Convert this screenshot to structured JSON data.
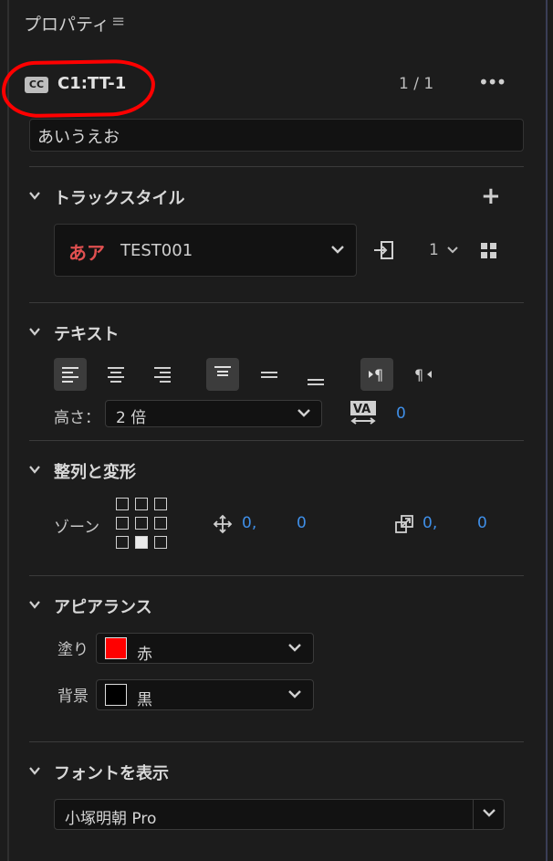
{
  "panel": {
    "title": "プロパティ",
    "menu_icon": "hamburger-icon"
  },
  "caption": {
    "badge": "CC",
    "name": "C1:TT-1",
    "page": "1 / 1",
    "more_icon": "more-icon",
    "text": "あいうえお"
  },
  "track_style": {
    "title": "トラックスタイル",
    "preview": "あア",
    "style_name": "TEST001",
    "count": "1"
  },
  "text_section": {
    "title": "テキスト",
    "height_label": "高さ：",
    "height_value": "2 倍",
    "tracking_value": "0"
  },
  "align_section": {
    "title": "整列と変形",
    "zone_label": "ゾーン",
    "pos_x": "0,",
    "pos_y": "0",
    "scale_x": "0,",
    "scale_y": "0"
  },
  "appearance": {
    "title": "アピアランス",
    "fill_label": "塗り",
    "fill_value": "赤",
    "fill_color": "#ff0000",
    "bg_label": "背景",
    "bg_value": "黒",
    "bg_color": "#000000"
  },
  "font_section": {
    "title": "フォントを表示",
    "font_value": "小塚明朝 Pro"
  },
  "colors": {
    "accent": "#3f8fe8",
    "highlight": "#ff0000"
  }
}
